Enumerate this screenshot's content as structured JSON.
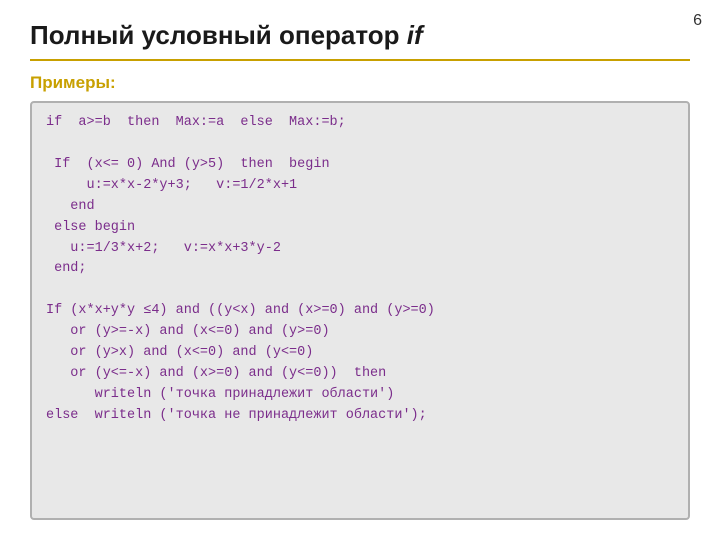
{
  "page": {
    "number": "6",
    "title": {
      "text_plain": "Полный условный оператор ",
      "text_italic": "if"
    },
    "examples_label": "Примеры:",
    "code_lines": [
      "if  a>=b  then  Max:=a  else  Max:=b;",
      "",
      " If  (x<= 0) And (y>5)  then  begin",
      "     u:=x*x-2*y+3;   v:=1/2*x+1",
      "   end",
      " else begin",
      "   u:=1/3*x+2;   v:=x*x+3*y-2",
      " end;",
      "",
      "If (x*x+y*y ≤4) and ((y<x) and (x>=0) and (y>=0)",
      "   or (y>=-x) and (x<=0) and (y>=0)",
      "   or (y>x) and (x<=0) and (y<=0)",
      "   or (y<=-x) and (x>=0) and (y<=0))  then",
      "      writeln ('точка принадлежит области')",
      "else  writeln ('точка не принадлежит области');"
    ]
  }
}
